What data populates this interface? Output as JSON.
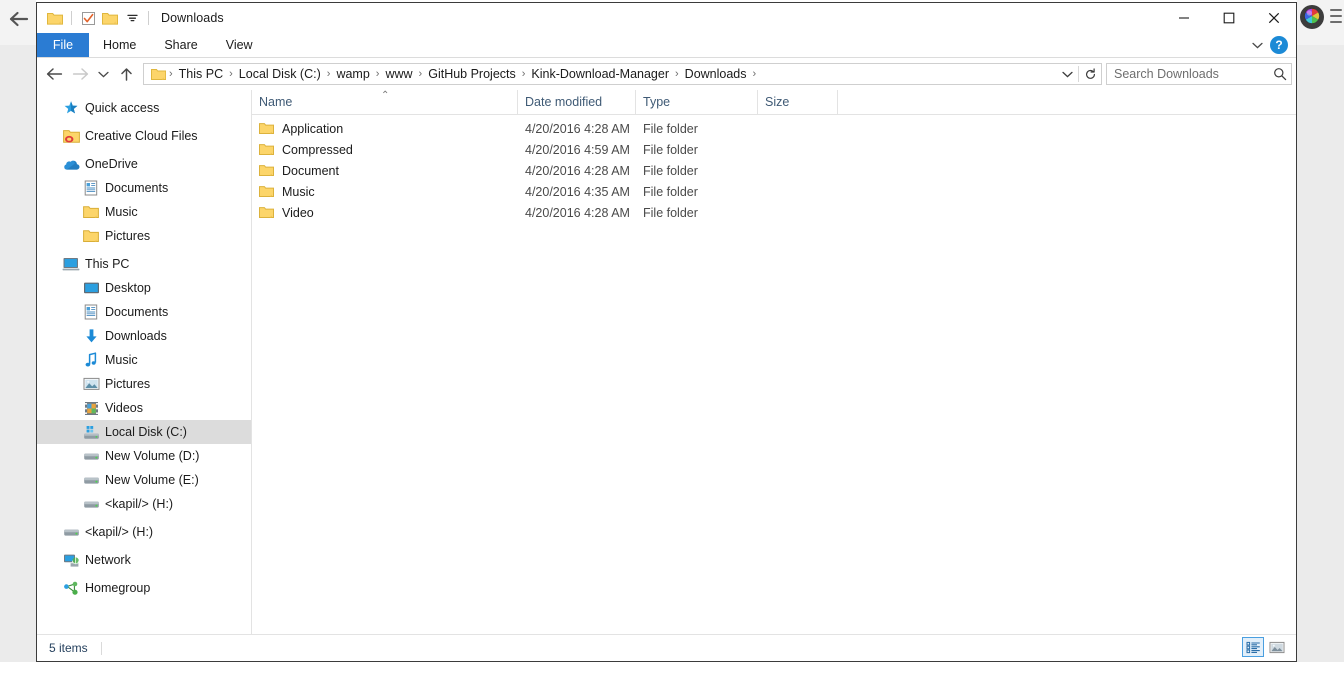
{
  "window": {
    "title": "Downloads",
    "quick_access_toolbar": [
      {
        "name": "properties-folder-icon",
        "label": "Properties"
      },
      {
        "name": "checkbox-new-folder-icon",
        "label": "New folder"
      },
      {
        "name": "customize-folder-icon",
        "label": "Customize Quick Access Toolbar"
      },
      {
        "name": "chevron-down-icon",
        "label": "Customize"
      }
    ],
    "controls": {
      "minimize": "—",
      "maximize": "□",
      "close": "✕"
    }
  },
  "ribbon": {
    "tabs": [
      {
        "label": "File",
        "active": true
      },
      {
        "label": "Home",
        "active": false
      },
      {
        "label": "Share",
        "active": false
      },
      {
        "label": "View",
        "active": false
      }
    ],
    "expand_label": "⌄",
    "help_label": "?"
  },
  "navigation": {
    "back_label": "←",
    "forward_label": "→",
    "recent_label": "⌄",
    "up_label": "↑",
    "breadcrumbs": [
      "This PC",
      "Local Disk (C:)",
      "wamp",
      "www",
      "GitHub Projects",
      "Kink-Download-Manager",
      "Downloads"
    ],
    "separator": "❯",
    "dropdown_label": "⌄",
    "refresh_label": "↻"
  },
  "search": {
    "placeholder": "Search Downloads",
    "value": ""
  },
  "sidebar": {
    "items": [
      {
        "label": "Quick access",
        "icon": "star-pin-icon",
        "indent": 0,
        "selected": false
      },
      {
        "label": "Creative Cloud Files",
        "icon": "creative-cloud-folder-icon",
        "indent": 0,
        "selected": false
      },
      {
        "label": "OneDrive",
        "icon": "onedrive-cloud-icon",
        "indent": 0,
        "selected": false
      },
      {
        "label": "Documents",
        "icon": "documents-icon",
        "indent": 1,
        "selected": false
      },
      {
        "label": "Music",
        "icon": "folder-icon",
        "indent": 1,
        "selected": false
      },
      {
        "label": "Pictures",
        "icon": "folder-icon",
        "indent": 1,
        "selected": false
      },
      {
        "label": "This PC",
        "icon": "this-pc-icon",
        "indent": 0,
        "selected": false
      },
      {
        "label": "Desktop",
        "icon": "desktop-icon",
        "indent": 1,
        "selected": false
      },
      {
        "label": "Documents",
        "icon": "documents-icon",
        "indent": 1,
        "selected": false
      },
      {
        "label": "Downloads",
        "icon": "downloads-arrow-icon",
        "indent": 1,
        "selected": false
      },
      {
        "label": "Music",
        "icon": "music-note-icon",
        "indent": 1,
        "selected": false
      },
      {
        "label": "Pictures",
        "icon": "pictures-icon",
        "indent": 1,
        "selected": false
      },
      {
        "label": "Videos",
        "icon": "videos-film-icon",
        "indent": 1,
        "selected": false
      },
      {
        "label": "Local Disk (C:)",
        "icon": "windows-drive-icon",
        "indent": 1,
        "selected": true
      },
      {
        "label": "New Volume (D:)",
        "icon": "drive-icon",
        "indent": 1,
        "selected": false
      },
      {
        "label": "New Volume (E:)",
        "icon": "drive-icon",
        "indent": 1,
        "selected": false
      },
      {
        "label": "<kapil/>  (H:)",
        "icon": "drive-icon",
        "indent": 1,
        "selected": false
      },
      {
        "label": "<kapil/>  (H:)",
        "icon": "drive-icon",
        "indent": 0,
        "selected": false
      },
      {
        "label": "Network",
        "icon": "network-icon",
        "indent": 0,
        "selected": false
      },
      {
        "label": "Homegroup",
        "icon": "homegroup-icon",
        "indent": 0,
        "selected": false
      }
    ]
  },
  "file_list": {
    "columns": [
      {
        "label": "Name",
        "sorted": true,
        "sort_direction": "asc"
      },
      {
        "label": "Date modified",
        "sorted": false
      },
      {
        "label": "Type",
        "sorted": false
      },
      {
        "label": "Size",
        "sorted": false
      }
    ],
    "sort_indicator": "⌃",
    "rows": [
      {
        "name": "Application",
        "date": "4/20/2016 4:28 AM",
        "type": "File folder",
        "size": "",
        "icon": "folder-icon"
      },
      {
        "name": "Compressed",
        "date": "4/20/2016 4:59 AM",
        "type": "File folder",
        "size": "",
        "icon": "folder-icon"
      },
      {
        "name": "Document",
        "date": "4/20/2016 4:28 AM",
        "type": "File folder",
        "size": "",
        "icon": "folder-icon"
      },
      {
        "name": "Music",
        "date": "4/20/2016 4:35 AM",
        "type": "File folder",
        "size": "",
        "icon": "folder-icon"
      },
      {
        "name": "Video",
        "date": "4/20/2016 4:28 AM",
        "type": "File folder",
        "size": "",
        "icon": "folder-icon"
      }
    ]
  },
  "status": {
    "item_count": "5 items",
    "views": [
      {
        "name": "details-view-button",
        "label": "Details view",
        "active": true
      },
      {
        "name": "large-icons-view-button",
        "label": "Large icons view",
        "active": false
      }
    ]
  },
  "desktop": {
    "back_label": "←",
    "colorwheel_label": "Color picker",
    "menu_label": "Menu"
  },
  "colors": {
    "accent_blue": "#2b7cd3",
    "folder_yellow": "#fcd56a",
    "selection_gray": "#dcdcdc",
    "header_text": "#3f5a75",
    "status_text": "#26415e"
  }
}
